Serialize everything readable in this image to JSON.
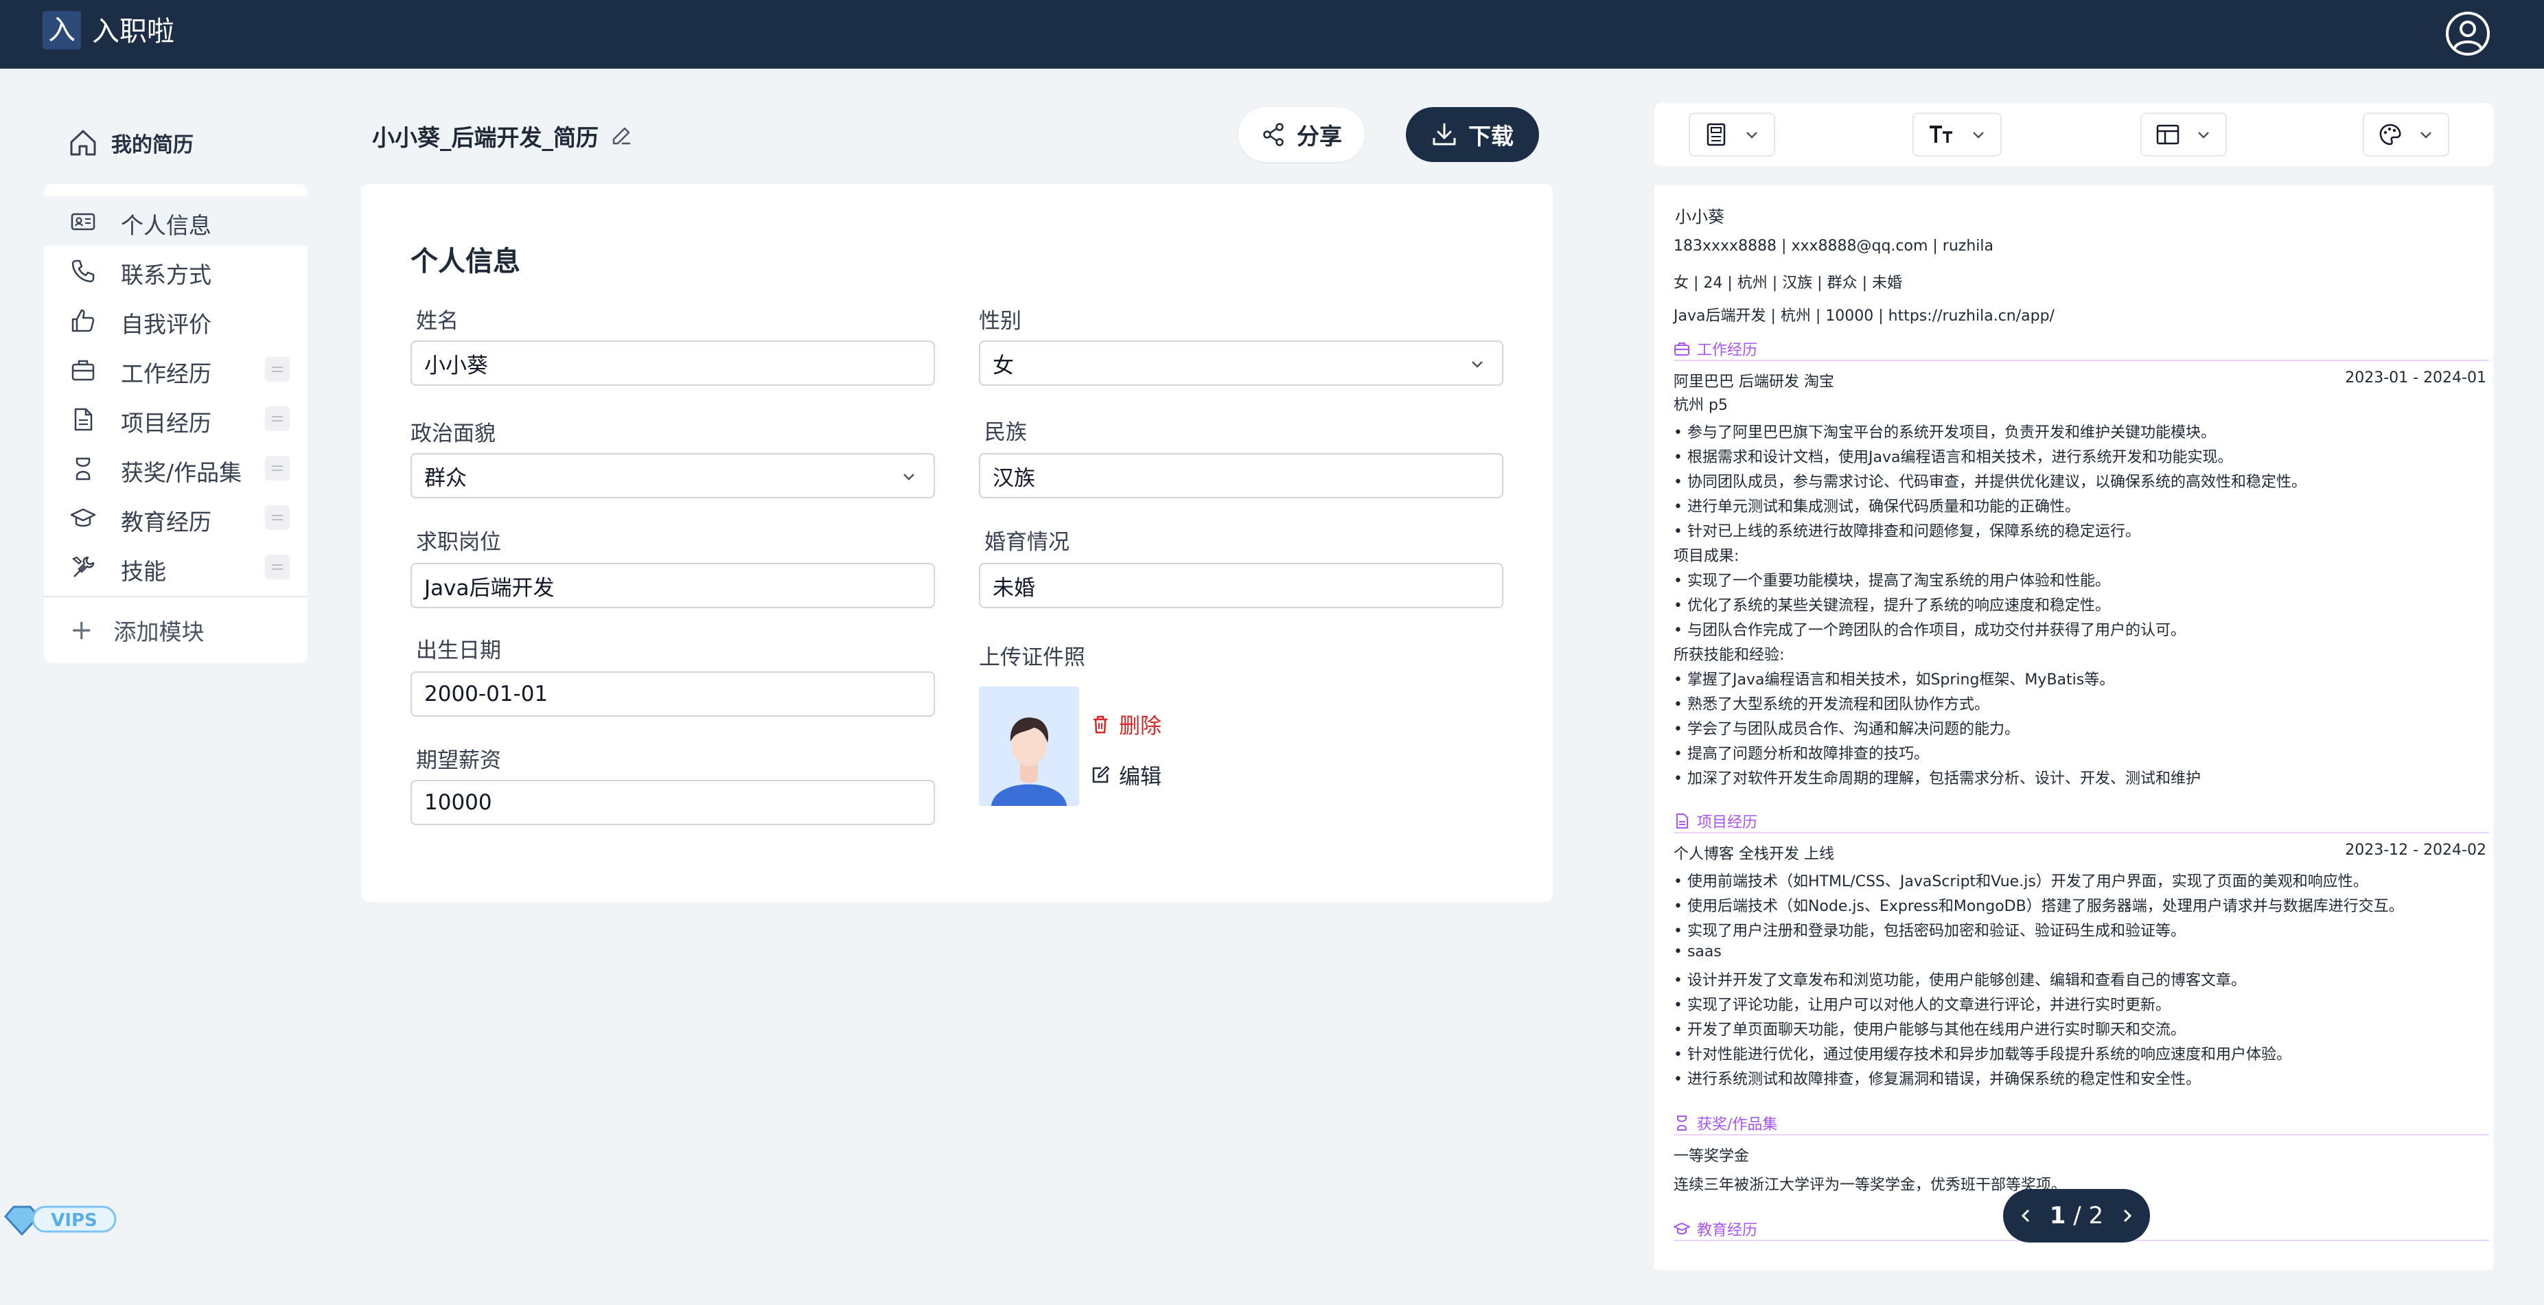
{
  "app": {
    "logo_char": "入",
    "name": "入职啦"
  },
  "sidebar": {
    "my_resume": "我的简历",
    "items": [
      {
        "label": "个人信息",
        "icon": "id-card-icon"
      },
      {
        "label": "联系方式",
        "icon": "phone-icon"
      },
      {
        "label": "自我评价",
        "icon": "thumbs-up-icon"
      },
      {
        "label": "工作经历",
        "icon": "briefcase-icon"
      },
      {
        "label": "项目经历",
        "icon": "document-icon"
      },
      {
        "label": "获奖/作品集",
        "icon": "trophy-icon"
      },
      {
        "label": "教育经历",
        "icon": "graduation-cap-icon"
      },
      {
        "label": "技能",
        "icon": "tools-icon"
      }
    ],
    "add_module": "添加模块"
  },
  "header": {
    "resume_title": "小小葵_后端开发_简历",
    "share": "分享",
    "download": "下载"
  },
  "form": {
    "title": "个人信息",
    "name_label": "姓名",
    "name_value": "小小葵",
    "gender_label": "性别",
    "gender_value": "女",
    "politics_label": "政治面貌",
    "politics_value": "群众",
    "ethnicity_label": "民族",
    "ethnicity_value": "汉族",
    "position_label": "求职岗位",
    "position_value": "Java后端开发",
    "marital_label": "婚育情况",
    "marital_value": "未婚",
    "birth_label": "出生日期",
    "birth_value": "2000-01-01",
    "photo_label": "上传证件照",
    "salary_label": "期望薪资",
    "salary_value": "10000",
    "delete": "删除",
    "edit": "编辑"
  },
  "preview": {
    "name": "小小葵",
    "contact": "183xxxx8888 | xxx8888@qq.com | ruzhila",
    "info": "女 | 24 | 杭州 | 汉族 | 群众 | 未婚",
    "intent": "Java后端开发 | 杭州 | 10000 | https://ruzhila.cn/app/",
    "work": {
      "heading": "工作经历",
      "company_line": "阿里巴巴    后端研发       淘宝",
      "dates": "2023-01 - 2024-01",
      "city_line": "杭州   p5",
      "lines": [
        "• 参与了阿里巴巴旗下淘宝平台的系统开发项目，负责开发和维护关键功能模块。",
        "• 根据需求和设计文档，使用Java编程语言和相关技术，进行系统开发和功能实现。",
        "• 协同团队成员，参与需求讨论、代码审查，并提供优化建议，以确保系统的高效性和稳定性。",
        "• 进行单元测试和集成测试，确保代码质量和功能的正确性。",
        "• 针对已上线的系统进行故障排查和问题修复，保障系统的稳定运行。",
        "项目成果:",
        "• 实现了一个重要功能模块，提高了淘宝系统的用户体验和性能。",
        "• 优化了系统的某些关键流程，提升了系统的响应速度和稳定性。",
        "• 与团队合作完成了一个跨团队的合作项目，成功交付并获得了用户的认可。",
        "所获技能和经验:",
        "• 掌握了Java编程语言和相关技术，如Spring框架、MyBatis等。",
        "• 熟悉了大型系统的开发流程和团队协作方式。",
        "• 学会了与团队成员合作、沟通和解决问题的能力。",
        "• 提高了问题分析和故障排查的技巧。",
        "• 加深了对软件开发生命周期的理解，包括需求分析、设计、开发、测试和维护"
      ]
    },
    "project": {
      "heading": "项目经历",
      "title_line": "个人博客   全栈开发       上线",
      "dates": "2023-12 - 2024-02",
      "lines": [
        "• 使用前端技术（如HTML/CSS、JavaScript和Vue.js）开发了用户界面，实现了页面的美观和响应性。",
        "• 使用后端技术（如Node.js、Express和MongoDB）搭建了服务器端，处理用户请求并与数据库进行交互。",
        "• 实现了用户注册和登录功能，包括密码加密和验证、验证码生成和验证等。",
        "• saas",
        "• 设计并开发了文章发布和浏览功能，使用户能够创建、编辑和查看自己的博客文章。",
        "• 实现了评论功能，让用户可以对他人的文章进行评论，并进行实时更新。",
        "• 开发了单页面聊天功能，使用户能够与其他在线用户进行实时聊天和交流。",
        "• 针对性能进行优化，通过使用缓存技术和异步加载等手段提升系统的响应速度和用户体验。",
        "• 进行系统测试和故障排查，修复漏洞和错误，并确保系统的稳定性和安全性。"
      ]
    },
    "awards": {
      "heading": "获奖/作品集",
      "title": "一等奖学金",
      "desc": "连续三年被浙江大学评为一等奖学金，优秀班干部等奖项。"
    },
    "education": {
      "heading": "教育经历"
    }
  },
  "pager": {
    "current": "1",
    "total": "/ 2"
  },
  "vip_badge": "VIPS"
}
